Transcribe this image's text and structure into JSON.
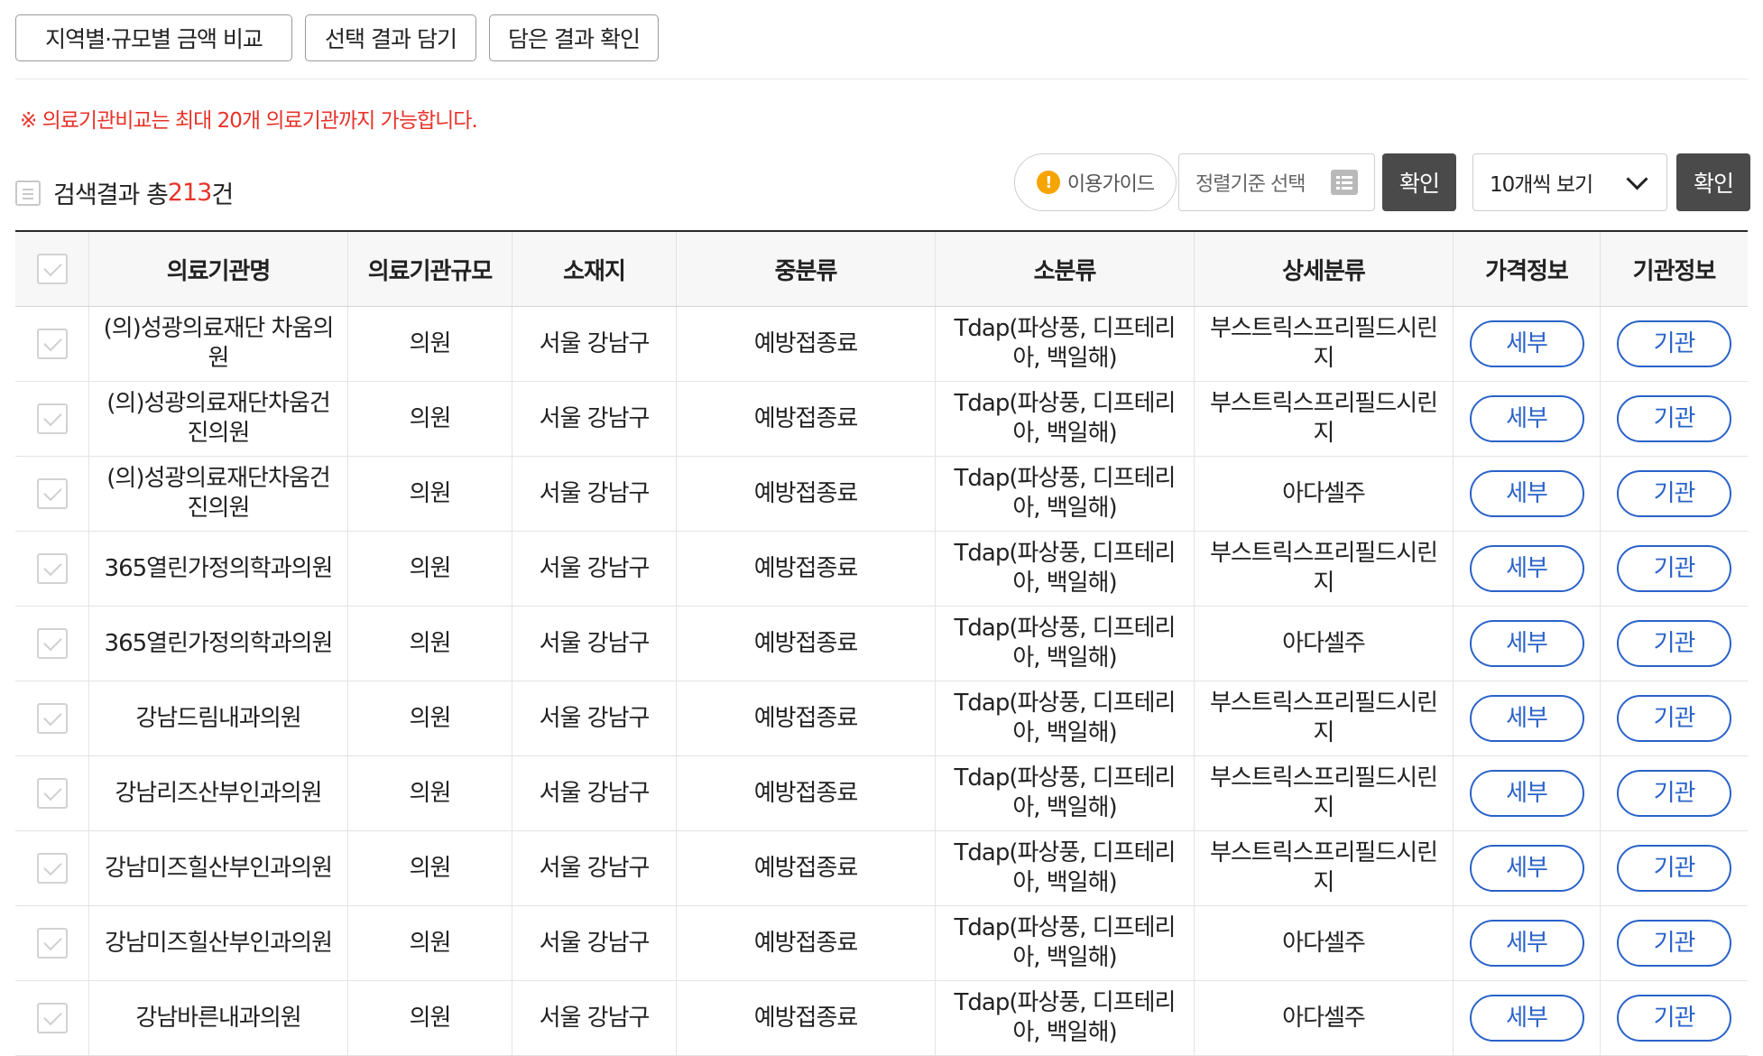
{
  "top_buttons": {
    "compare": "지역별·규모별 금액 비교",
    "add_selected": "선택 결과 담기",
    "view_saved": "담은 결과 확인"
  },
  "notice": "※ 의료기관비교는 최대 20개 의료기관까지 가능합니다.",
  "result": {
    "prefix": "검색결과 총",
    "count": "213",
    "suffix": "건"
  },
  "toolbar": {
    "guide_label": "이용가이드",
    "sort_placeholder": "정렬기준 선택",
    "confirm_label": "확인",
    "page_size_value": "10개씩 보기",
    "confirm_label_2": "확인"
  },
  "table": {
    "headers": [
      "의료기관명",
      "의료기관규모",
      "소재지",
      "중분류",
      "소분류",
      "상세분류",
      "가격정보",
      "기관정보"
    ],
    "detail_button": "세부",
    "institution_button": "기관",
    "rows": [
      {
        "name": "(의)성광의료재단 차움의원",
        "size": "의원",
        "location": "서울 강남구",
        "mid": "예방접종료",
        "sub": "Tdap(파상풍, 디프테리아, 백일해)",
        "detail": "부스트릭스프리필드시린지"
      },
      {
        "name": "(의)성광의료재단차움건진의원",
        "size": "의원",
        "location": "서울 강남구",
        "mid": "예방접종료",
        "sub": "Tdap(파상풍, 디프테리아, 백일해)",
        "detail": "부스트릭스프리필드시린지"
      },
      {
        "name": "(의)성광의료재단차움건진의원",
        "size": "의원",
        "location": "서울 강남구",
        "mid": "예방접종료",
        "sub": "Tdap(파상풍, 디프테리아, 백일해)",
        "detail": "아다셀주"
      },
      {
        "name": "365열린가정의학과의원",
        "size": "의원",
        "location": "서울 강남구",
        "mid": "예방접종료",
        "sub": "Tdap(파상풍, 디프테리아, 백일해)",
        "detail": "부스트릭스프리필드시린지"
      },
      {
        "name": "365열린가정의학과의원",
        "size": "의원",
        "location": "서울 강남구",
        "mid": "예방접종료",
        "sub": "Tdap(파상풍, 디프테리아, 백일해)",
        "detail": "아다셀주"
      },
      {
        "name": "강남드림내과의원",
        "size": "의원",
        "location": "서울 강남구",
        "mid": "예방접종료",
        "sub": "Tdap(파상풍, 디프테리아, 백일해)",
        "detail": "부스트릭스프리필드시린지"
      },
      {
        "name": "강남리즈산부인과의원",
        "size": "의원",
        "location": "서울 강남구",
        "mid": "예방접종료",
        "sub": "Tdap(파상풍, 디프테리아, 백일해)",
        "detail": "부스트릭스프리필드시린지"
      },
      {
        "name": "강남미즈힐산부인과의원",
        "size": "의원",
        "location": "서울 강남구",
        "mid": "예방접종료",
        "sub": "Tdap(파상풍, 디프테리아, 백일해)",
        "detail": "부스트릭스프리필드시린지"
      },
      {
        "name": "강남미즈힐산부인과의원",
        "size": "의원",
        "location": "서울 강남구",
        "mid": "예방접종료",
        "sub": "Tdap(파상풍, 디프테리아, 백일해)",
        "detail": "아다셀주"
      },
      {
        "name": "강남바른내과의원",
        "size": "의원",
        "location": "서울 강남구",
        "mid": "예방접종료",
        "sub": "Tdap(파상풍, 디프테리아, 백일해)",
        "detail": "아다셀주"
      }
    ]
  },
  "colors": {
    "accent_blue": "#2a62c9",
    "notice_red": "#e8332a",
    "dark_button": "#4a4a4a"
  }
}
